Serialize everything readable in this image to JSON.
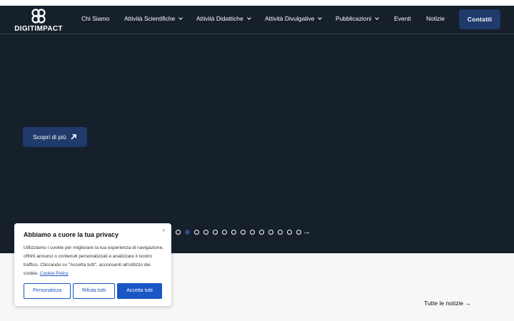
{
  "brand": {
    "name": "DIGITIMPACT"
  },
  "nav": {
    "items": [
      {
        "label": "Chi Siamo"
      },
      {
        "label": "Attività Scientifiche"
      },
      {
        "label": "Attività Didattiche"
      },
      {
        "label": "Attività Divulgative"
      },
      {
        "label": "Pubblicazioni"
      },
      {
        "label": "Eventi"
      },
      {
        "label": "Notizie"
      }
    ],
    "cta_label": "Contatti"
  },
  "hero": {
    "cta_label": "Scopri di più",
    "slider": {
      "slide_count": 14,
      "active_index": 1
    }
  },
  "news": {
    "all_link": "Tutte le notizie →"
  },
  "cookie": {
    "title": "Abbiamo a cuore la tua privacy",
    "body": "Utilizziamo i cookie per migliorare la tua esperienza di navigazione, offrirti annunci o contenuti personalizzati e analizzare il nostro traffico. Cliccando su \"Accetta tutti\", acconsenti all'utilizzo dei cookie.",
    "policy_link": "Cookie Policy",
    "close": "×",
    "buttons": {
      "customize": "Personalizza",
      "reject": "Rifiuta tutti",
      "accept": "Accetta tutti"
    }
  },
  "colors": {
    "dark_bg": "#16202b",
    "accent": "#1f3a6b",
    "link_blue": "#1a56c4"
  }
}
